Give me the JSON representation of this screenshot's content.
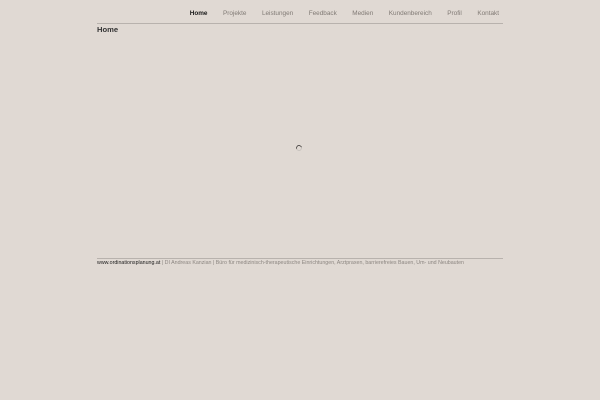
{
  "nav": {
    "items": [
      {
        "label": "Home",
        "active": true
      },
      {
        "label": "Projekte",
        "active": false
      },
      {
        "label": "Leistungen",
        "active": false
      },
      {
        "label": "Feedback",
        "active": false
      },
      {
        "label": "Medien",
        "active": false
      },
      {
        "label": "Kundenbereich",
        "active": false
      },
      {
        "label": "Profil",
        "active": false
      },
      {
        "label": "Kontakt",
        "active": false
      }
    ]
  },
  "main": {
    "title": "Home",
    "loading_icon": "spinner-icon"
  },
  "footer": {
    "site_link": "www.ordinationsplanung.at",
    "separator": " | ",
    "text": "DI Andreas Kanzian | Büro für medizinisch-therapeutische Einrichtungen, Arztpraxen, barrierefreies Bauen, Um- und Neubauten"
  },
  "colors": {
    "background": "#e0d9d3",
    "text_dark": "#1a1a1a",
    "text_muted": "#807a75",
    "divider": "#b8b2ad"
  }
}
